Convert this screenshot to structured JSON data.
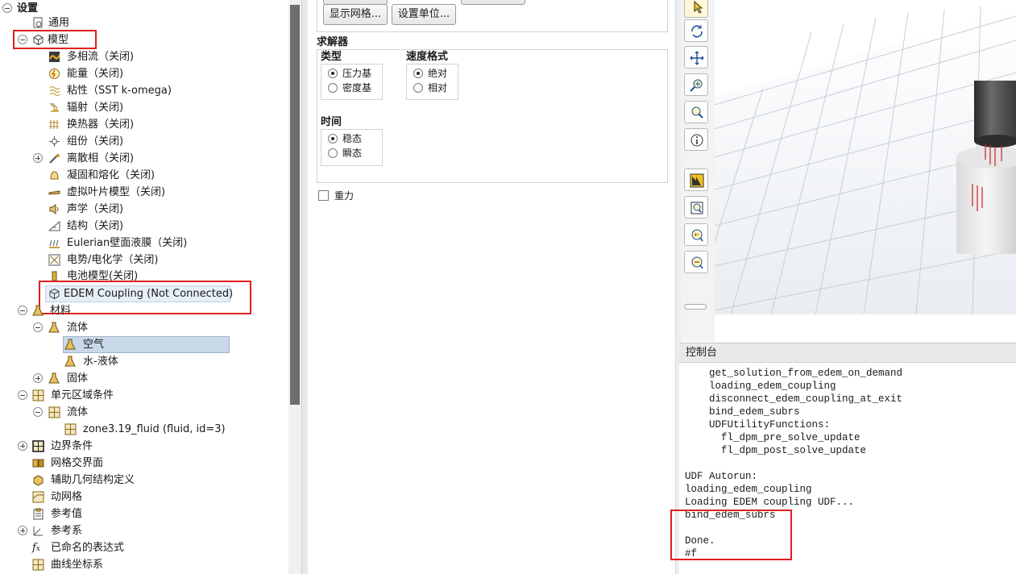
{
  "tree": {
    "settings": "设置",
    "general": "通用",
    "models": "模型",
    "model_items": [
      "多相流（关闭)",
      "能量（关闭)",
      "粘性（SST k-omega)",
      "辐射（关闭)",
      "换热器（关闭)",
      "组份（关闭)",
      "离散相（关闭)",
      "凝固和熔化（关闭)",
      "虚拟叶片模型（关闭)",
      "声学（关闭)",
      "结构（关闭)",
      "Eulerian壁面液膜（关闭)",
      "电势/电化学（关闭)",
      "电池模型(关闭)",
      "EDEM Coupling (Not Connected)"
    ],
    "materials": "材料",
    "fluid": "流体",
    "air": "空气",
    "water": "水-液体",
    "solid": "固体",
    "cell_zone": "单元区域条件",
    "cell_zone_fluid": "流体",
    "zone": "zone3.19_fluid (fluid, id=3)",
    "boundary": "边界条件",
    "mesh_interfaces": "网格交界面",
    "aux_geometry": "辅助几何结构定义",
    "dynamic_mesh": "动网格",
    "reference_values": "参考值",
    "reference_frames": "参考系",
    "named_expressions": "已命名的表达式",
    "curvilinear": "曲线坐标系"
  },
  "mesh_buttons": {
    "display_mesh": "显示网格...",
    "set_units": "设置单位..."
  },
  "solver": {
    "title": "求解器",
    "type_title": "类型",
    "type_options": [
      "压力基",
      "密度基"
    ],
    "type_selected": 0,
    "velocity_title": "速度格式",
    "velocity_options": [
      "绝对",
      "相对"
    ],
    "velocity_selected": 0,
    "time_title": "时间",
    "time_options": [
      "稳态",
      "瞬态"
    ],
    "time_selected": 0
  },
  "gravity": {
    "label": "重力",
    "checked": false
  },
  "console": {
    "title": "控制台",
    "lines": [
      "    get_solution_from_edem_on_demand",
      "    loading_edem_coupling",
      "    disconnect_edem_coupling_at_exit",
      "    bind_edem_subrs",
      "    UDFUtilityFunctions:",
      "      fl_dpm_pre_solve_update",
      "      fl_dpm_post_solve_update",
      "",
      "UDF Autorun:",
      "loading_edem_coupling",
      "Loading EDEM coupling UDF...",
      "bind_edem_subrs",
      "",
      "Done.",
      "#f"
    ]
  },
  "colors": {
    "highlight": "#e02020",
    "selection": "#c8d8e8",
    "scrollbar_thumb": "#6e6e6e"
  },
  "icons": {
    "toolbar": [
      "pointer-icon",
      "rotate-icon",
      "pan-icon",
      "zoom-in-out-icon",
      "zoom-icon",
      "probe-icon",
      "display-icon",
      "fit-window-icon",
      "zoom-to-fit-icon",
      "zoom-out-icon"
    ]
  }
}
